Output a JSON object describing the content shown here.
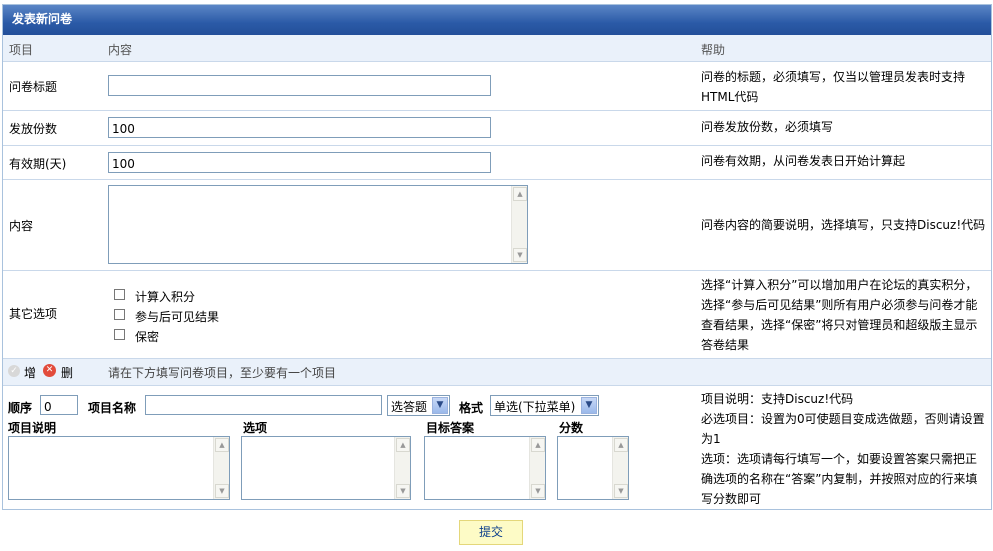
{
  "panel_title": "发表新问卷",
  "header": {
    "col_item": "项目",
    "col_content": "内容",
    "col_help": "帮助"
  },
  "fields": {
    "title": {
      "label": "问卷标题",
      "value": "",
      "help": "问卷的标题，必须填写，仅当以管理员发表时支持HTML代码"
    },
    "copies": {
      "label": "发放份数",
      "value": "100",
      "help": "问卷发放份数，必须填写"
    },
    "validity": {
      "label": "有效期(天)",
      "value": "100",
      "help": "问卷有效期，从问卷发表日开始计算起"
    },
    "content": {
      "label": "内容",
      "help": "问卷内容的简要说明，选择填写，只支持Discuz!代码"
    },
    "other": {
      "label": "其它选项",
      "options": [
        "计算入积分",
        "参与后可见结果",
        "保密"
      ],
      "help": "选择“计算入积分”可以增加用户在论坛的真实积分，选择“参与后可见结果”则所有用户必须参与问卷才能查看结果，选择“保密”将只对管理员和超级版主显示答卷结果"
    }
  },
  "addbar": {
    "add_label": "增",
    "delete_label": "删",
    "hint": "请在下方填写问卷项目，至少要有一个项目"
  },
  "item": {
    "order_label": "顺序",
    "order_value": "0",
    "name_label": "项目名称",
    "name_value": "",
    "type_select": "选答题",
    "format_label": "格式",
    "format_select": "单选(下拉菜单)",
    "desc_label": "项目说明",
    "options_label": "选项",
    "answer_label": "目标答案",
    "score_label": "分数",
    "help": [
      "项目说明：支持Discuz!代码",
      "必选项目：设置为0可使题目变成选做题，否则请设置为1",
      "选项：选项请每行填写一个，如要设置答案只需把正确选项的名称在“答案”内复制，并按照对应的行来填写分数即可"
    ]
  },
  "submit_label": "提交"
}
